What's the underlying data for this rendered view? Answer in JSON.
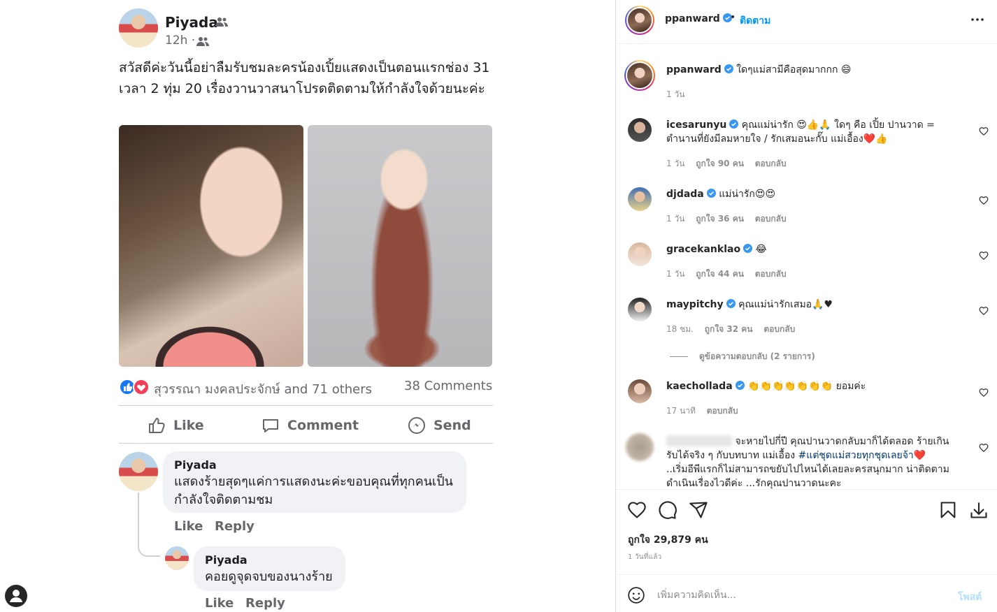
{
  "facebook": {
    "author": "Piyada",
    "time": "12h ·",
    "post_text": "สวัสดีค่ะวันนี้อย่าลืมรับชมละครน้องเปิ้ยแสดงเป็นตอนแรกช่อง 31 เวลา 2 ทุ่ม 20 เรื่องวานวาสนาโปรดติดตามให้กำลังใจด้วยนะค่ะ",
    "reactions_text": "สุวรรณา มงคลประจักษ์ and 71 others",
    "comments_count": "38 Comments",
    "actions": {
      "like": "Like",
      "comment": "Comment",
      "send": "Send"
    },
    "comments": [
      {
        "author": "Piyada",
        "text": "แสดงร้ายสุดๆแค่การแสดงนะค่ะขอบคุณที่ทุกคนเป็นกำลังใจติดตามชม",
        "like": "Like",
        "reply": "Reply"
      },
      {
        "author": "Piyada",
        "text": "คอยดูจุดจบของนางร้าย",
        "like": "Like",
        "reply": "Reply"
      }
    ]
  },
  "instagram": {
    "header": {
      "username": "ppanward",
      "dot": "•",
      "follow": "ติดตาม"
    },
    "caption": {
      "username": "ppanward",
      "text": "ใดๆแม่สามีคือสุดมากกก 😄",
      "time": "1 วัน"
    },
    "comments": [
      {
        "username": "icesarunyu",
        "text": "คุณแม่น่ารัก 😍👍🙏 ใดๆ คือ เปิ้ย ปานวาด = ตำนานที่ยังมีลมหายใจ / รักเสมอนะกั๊บ แม่เอื้อง❤️👍",
        "time": "1 วัน",
        "likes": "ถูกใจ 90 คน",
        "reply": "ตอบกลับ"
      },
      {
        "username": "djdada",
        "text": "แม่น่ารัก😍😍",
        "time": "1 วัน",
        "likes": "ถูกใจ 36 คน",
        "reply": "ตอบกลับ"
      },
      {
        "username": "gracekanklao",
        "text": "😂",
        "time": "1 วัน",
        "likes": "ถูกใจ 44 คน",
        "reply": "ตอบกลับ"
      },
      {
        "username": "maypitchy",
        "text": "คุณแม่น่ารักเสมอ🙏♥",
        "time": "18 ชม.",
        "likes": "ถูกใจ 32 คน",
        "reply": "ตอบกลับ"
      },
      {
        "username": "kaechollada",
        "text": "👏👏👏👏👏👏👏 ยอมค่ะ",
        "time": "17 นาที",
        "reply": "ตอบกลับ"
      }
    ],
    "view_replies": "ดูข้อความตอบกลับ (2 รายการ)",
    "last_comment": {
      "text_a": "จะหายไปกี่ปี คุณปานวาดกลับมาก็ได้ตลอด ร้ายเกินรับได้จริง ๆ กับบทบาท แม่เอื้อง ",
      "hashtag": "#แต่ชุดแม่สวยทุกชุดเลยจ้า",
      "text_b": "❤️ ..เริ่มอีพีแรกก็ไม่สามารถขยับไปไหนได้เลยละครสนุกมาก น่าติดตาม ดำเนินเรื่องไวดีค่ะ ...รักคุณปานวาดนะคะ"
    },
    "likes": "ถูกใจ 29,879 คน",
    "post_time": "1 วันที่แล้ว",
    "comment_placeholder": "เพิ่มความคิดเห็น...",
    "post_button": "โพสต์",
    "colors": {
      "link": "#0095f6",
      "verified": "#3897f0",
      "muted": "#8e8e8e"
    }
  },
  "icons": [
    "friends-icon",
    "like-icon",
    "comment-icon",
    "messenger-icon",
    "user-icon",
    "verified-icon",
    "more-icon",
    "heart-icon",
    "speech-bubble-icon",
    "share-icon",
    "bookmark-icon",
    "download-icon",
    "emoji-icon"
  ]
}
